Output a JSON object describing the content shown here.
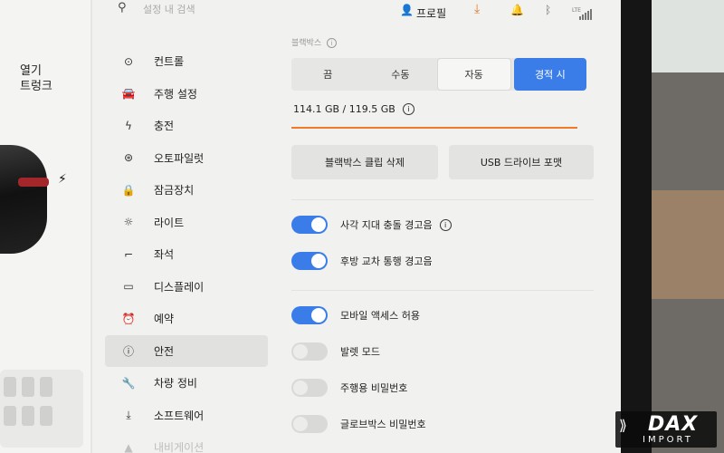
{
  "car": {
    "open_label_line1": "열기",
    "open_label_line2": "트렁크",
    "charge_icon": "bolt-icon"
  },
  "topbar": {
    "search_placeholder": "설정 내 검색",
    "profile_label": "프로필",
    "lte_label": "LTE",
    "icons": [
      "search-icon",
      "profile-icon",
      "download-icon",
      "bell-icon",
      "bluetooth-icon",
      "signal-icon"
    ],
    "download_color": "#e07a2a"
  },
  "sidebar": {
    "items": [
      {
        "label": "컨트롤",
        "icon": "toggle-icon"
      },
      {
        "label": "주행 설정",
        "icon": "car-icon"
      },
      {
        "label": "충전",
        "icon": "bolt-icon"
      },
      {
        "label": "오토파일럿",
        "icon": "steering-wheel-icon"
      },
      {
        "label": "잠금장치",
        "icon": "lock-icon"
      },
      {
        "label": "라이트",
        "icon": "sun-icon"
      },
      {
        "label": "좌석",
        "icon": "seat-icon"
      },
      {
        "label": "디스플레이",
        "icon": "display-icon"
      },
      {
        "label": "예약",
        "icon": "alarm-clock-icon"
      },
      {
        "label": "안전",
        "icon": "alert-circle-icon",
        "active": true
      },
      {
        "label": "차량 정비",
        "icon": "wrench-icon"
      },
      {
        "label": "소프트웨어",
        "icon": "download-icon"
      },
      {
        "label": "내비게이션",
        "icon": "navigation-icon"
      }
    ]
  },
  "dashcam": {
    "section_label": "블랙박스",
    "modes": [
      "끔",
      "수동",
      "자동",
      "경적 시"
    ],
    "selected_mode": "자동",
    "highlighted_mode": "경적 시",
    "storage_text": "114.1 GB / 119.5 GB",
    "storage_fraction": 0.955,
    "delete_button": "블랙박스 클립 삭제",
    "usb_button": "USB 드라이브 포맷"
  },
  "toggles": [
    {
      "label": "사각 지대 충돌 경고음",
      "on": true,
      "info": true
    },
    {
      "label": "후방 교차 통행 경고음",
      "on": true,
      "info": false
    },
    {
      "label": "모바일 액세스 허용",
      "on": true,
      "info": false
    },
    {
      "label": "발렛 모드",
      "on": false,
      "info": false
    },
    {
      "label": "주행용 비밀번호",
      "on": false,
      "info": false
    },
    {
      "label": "글로브박스 비밀번호",
      "on": false,
      "info": false
    }
  ],
  "colors": {
    "accent": "#3b7de8",
    "storage_bar": "#f07a2a",
    "active_nav_bg": "#e1e1df"
  },
  "watermark": {
    "name": "DAX",
    "sub": "IMPORT"
  }
}
